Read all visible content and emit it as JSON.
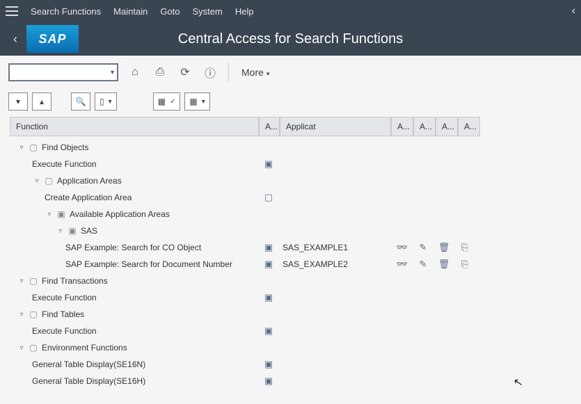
{
  "menu": {
    "items": [
      "Search Functions",
      "Maintain",
      "Goto",
      "System",
      "Help"
    ]
  },
  "titlebar": {
    "logo": "SAP",
    "title": "Central Access for Search Functions"
  },
  "toolbar": {
    "more": "More"
  },
  "columns": {
    "function": "Function",
    "a0": "A...",
    "applicat": "Applicat",
    "s1": "A...",
    "s2": "A...",
    "s3": "A...",
    "s4": "A..."
  },
  "tree": {
    "n1": {
      "label": "Find Objects"
    },
    "n1a": {
      "label": "Execute Function"
    },
    "n2": {
      "label": "Application Areas"
    },
    "n2a": {
      "label": "Create Application Area"
    },
    "n3": {
      "label": "Available Application Areas"
    },
    "n4": {
      "label": "SAS"
    },
    "n4a": {
      "label": "SAP Example: Search for CO Object",
      "app": "SAS_EXAMPLE1"
    },
    "n4b": {
      "label": "SAP Example: Search for Document Number",
      "app": "SAS_EXAMPLE2"
    },
    "n5": {
      "label": "Find Transactions"
    },
    "n5a": {
      "label": "Execute Function"
    },
    "n6": {
      "label": "Find Tables"
    },
    "n6a": {
      "label": "Execute Function"
    },
    "n7": {
      "label": "Environment Functions"
    },
    "n7a": {
      "label": "General Table Display(SE16N)"
    },
    "n7b": {
      "label": "General Table Display(SE16H)"
    }
  }
}
